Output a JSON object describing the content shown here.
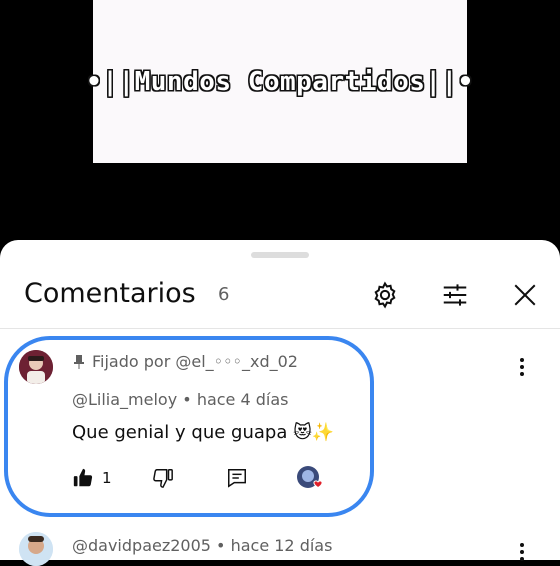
{
  "video": {
    "title": "•||Mundos Compartidos||•"
  },
  "comments_panel": {
    "title": "Comentarios",
    "count": "6",
    "icons": {
      "settings": "gear-icon",
      "filter": "sliders-icon",
      "close": "close-icon"
    },
    "comments": [
      {
        "pinned_label": "Fijado por @el_◦◦◦_xd_02",
        "author": "@Lilia_meloy",
        "time": "hace 4 días",
        "text": "Que genial y que guapa 😻✨",
        "likes": "1",
        "pinned": true
      },
      {
        "author": "@davidpaez2005",
        "time": "hace 12 días"
      }
    ],
    "accent_color": "#3a86f0"
  }
}
